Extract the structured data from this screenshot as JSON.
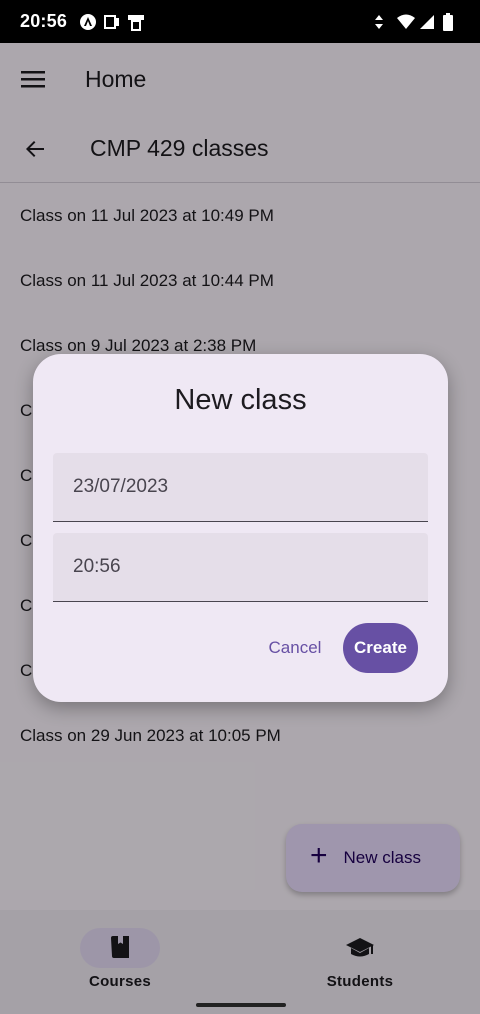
{
  "status_bar": {
    "time": "20:56",
    "left_icons": [
      "android-auto-icon",
      "card-icon",
      "cast-icon"
    ],
    "right_icons": [
      "data-arrows-icon",
      "wifi-icon",
      "signal-icon",
      "battery-icon"
    ]
  },
  "app_bar": {
    "title": "Home"
  },
  "sub_bar": {
    "title": "CMP 429 classes"
  },
  "classes": [
    "Class on 11 Jul 2023 at 10:49 PM",
    "Class on 11 Jul 2023 at 10:44 PM",
    "Class on 9 Jul 2023 at 2:38 PM",
    "C",
    "C",
    "C",
    "C",
    "C",
    "Class on 29 Jun 2023 at 10:05 PM"
  ],
  "fab": {
    "label": "New class",
    "icon": "plus-icon"
  },
  "dialog": {
    "title": "New class",
    "date_value": "23/07/2023",
    "time_value": "20:56",
    "cancel_label": "Cancel",
    "create_label": "Create"
  },
  "bottom_nav": {
    "items": [
      {
        "label": "Courses",
        "icon": "book-icon",
        "active": true
      },
      {
        "label": "Students",
        "icon": "graduation-cap-icon",
        "active": false
      }
    ]
  },
  "colors": {
    "primary": "#6750a4",
    "surface": "#fef7ff",
    "dialog_surface": "#efe8f4",
    "fab_container": "#eaddff",
    "nav_indicator": "#e8def8"
  }
}
